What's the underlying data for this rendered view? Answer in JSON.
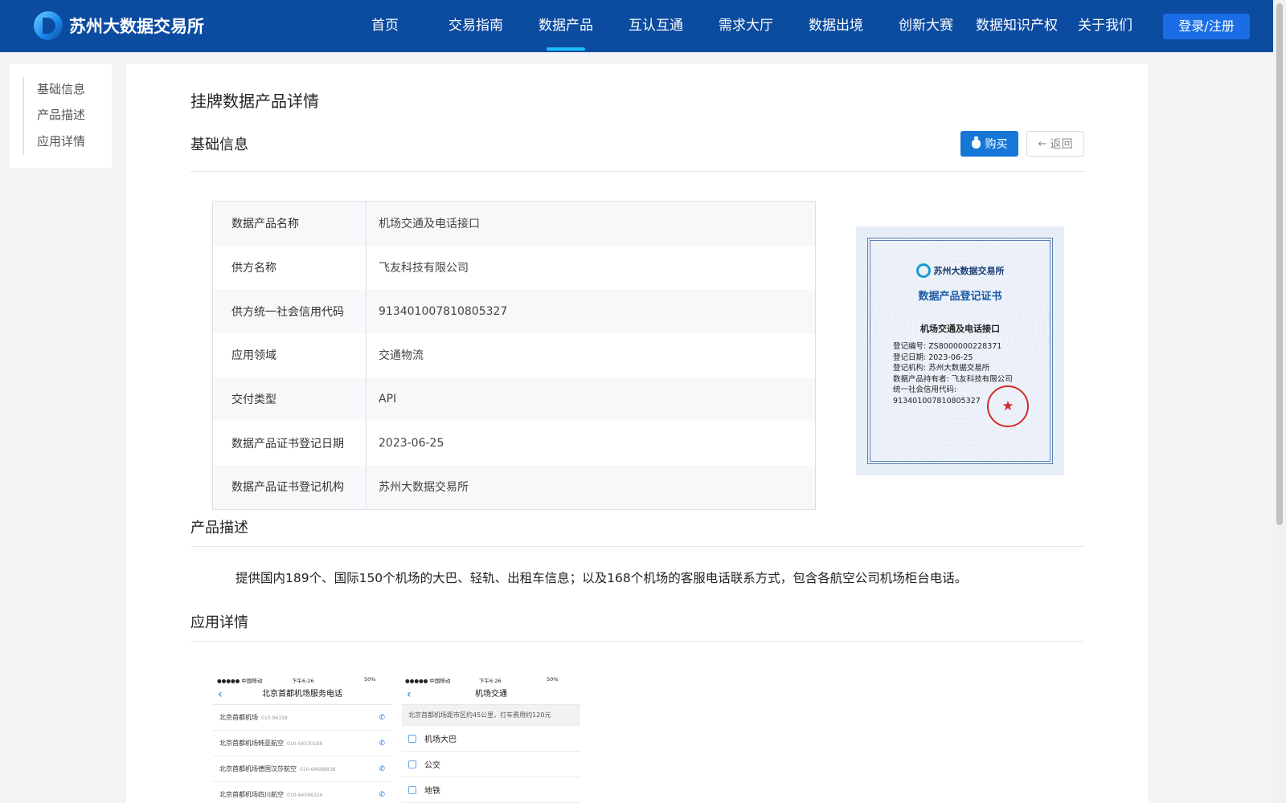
{
  "header": {
    "logo_text": "苏州大数据交易所",
    "nav": [
      "首页",
      "交易指南",
      "数据产品",
      "互认互通",
      "需求大厅",
      "数据出境",
      "创新大赛",
      "数据知识产权",
      "关于我们"
    ],
    "active_nav": "数据产品",
    "login_label": "登录/注册"
  },
  "sidenav": {
    "items": [
      "基础信息",
      "产品描述",
      "应用详情"
    ]
  },
  "main": {
    "page_title": "挂牌数据产品详情",
    "basic_section_title": "基础信息",
    "buy_label": "购买",
    "back_label": "返回",
    "info_rows": [
      {
        "label": "数据产品名称",
        "value": "机场交通及电话接口"
      },
      {
        "label": "供方名称",
        "value": "飞友科技有限公司"
      },
      {
        "label": "供方统一社会信用代码",
        "value": "913401007810805327"
      },
      {
        "label": "应用领域",
        "value": "交通物流"
      },
      {
        "label": "交付类型",
        "value": "API"
      },
      {
        "label": "数据产品证书登记日期",
        "value": "2023-06-25"
      },
      {
        "label": "数据产品证书登记机构",
        "value": "苏州大数据交易所"
      }
    ],
    "certificate": {
      "org": "苏州大数据交易所",
      "title": "数据产品登记证书",
      "product": "机场交通及电话接口",
      "lines": [
        "登记编号: ZS8000000228371",
        "登记日期: 2023-06-25",
        "登记机构: 苏州大数据交易所",
        "数据产品持有者: 飞友科技有限公司",
        "统一社会信用代码:",
        "913401007810805327"
      ]
    },
    "desc_section_title": "产品描述",
    "desc_text": "提供国内189个、国际150个机场的大巴、轻轨、出租车信息；以及168个机场的客服电话联系方式，包含各航空公司机场柜台电话。",
    "app_section_title": "应用详情",
    "phone1": {
      "carrier": "●●●●● 中国移动",
      "time": "下午6:26",
      "battery": "50%",
      "title": "北京首都机场服务电话",
      "rows": [
        {
          "name": "北京首都机场",
          "tel": "010-96158"
        },
        {
          "name": "北京首都机场韩亚航空",
          "tel": "010-64530186"
        },
        {
          "name": "北京首都机场德国汉莎航空",
          "tel": "010-64688838"
        },
        {
          "name": "北京首都机场四川航空",
          "tel": "010-64596324"
        }
      ]
    },
    "phone2": {
      "carrier": "●●●●● 中国移动",
      "time": "下午6:26",
      "battery": "50%",
      "title": "机场交通",
      "note": "北京首都机场距市区约45公里，打车费用约120元",
      "rows": [
        "机场大巴",
        "公交",
        "地铁"
      ]
    }
  },
  "colors": {
    "header_bg": "#0b4ba0",
    "accent": "#1677d6",
    "active_indicator": "#1ec0ff"
  }
}
